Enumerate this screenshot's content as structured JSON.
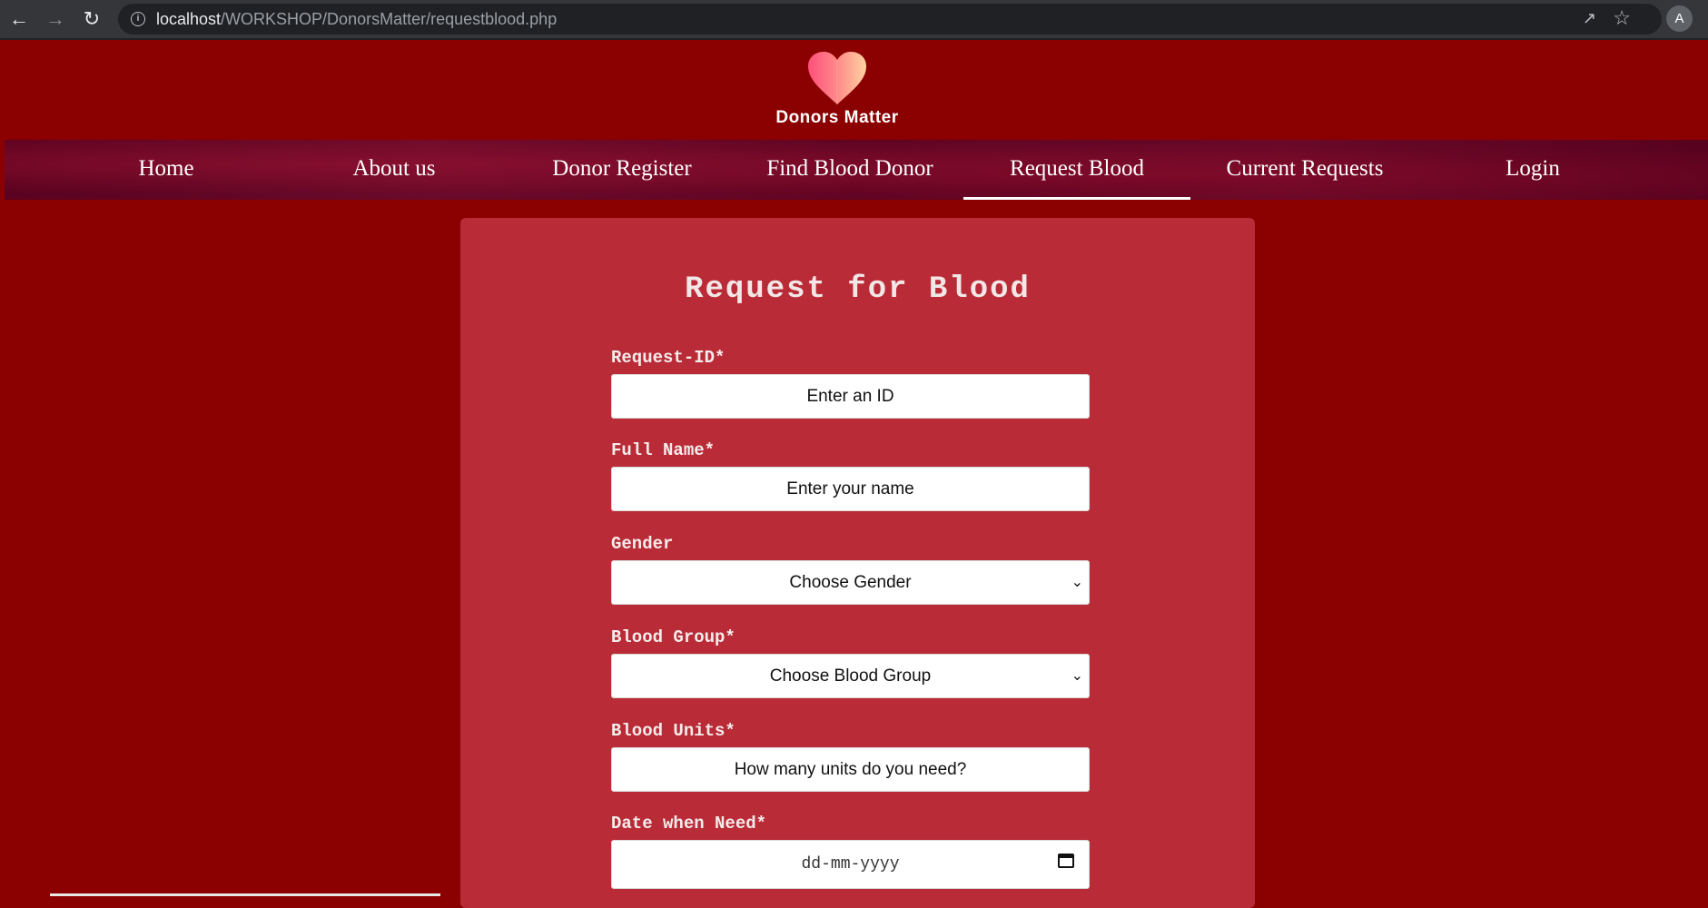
{
  "browser": {
    "url_host": "localhost",
    "url_path": "/WORKSHOP/DonorsMatter/requestblood.php",
    "avatar_letter": "A",
    "icons": [
      "back-icon",
      "forward-icon",
      "reload-icon",
      "info-icon",
      "share-icon",
      "star-icon"
    ]
  },
  "logo": {
    "text": "Donors Matter"
  },
  "nav": {
    "items": [
      {
        "label": "Home"
      },
      {
        "label": "About us"
      },
      {
        "label": "Donor Register"
      },
      {
        "label": "Find Blood Donor"
      },
      {
        "label": "Request Blood"
      },
      {
        "label": "Current Requests"
      },
      {
        "label": "Login"
      }
    ],
    "active": "Request Blood"
  },
  "form": {
    "title": "Request for Blood",
    "request_id": {
      "label": "Request-ID*",
      "placeholder": "Enter an ID"
    },
    "full_name": {
      "label": "Full Name*",
      "placeholder": "Enter your name"
    },
    "gender": {
      "label": "Gender",
      "selected": "Choose Gender"
    },
    "blood_group": {
      "label": "Blood Group*",
      "selected": "Choose Blood Group"
    },
    "blood_units": {
      "label": "Blood Units*",
      "placeholder": "How many units do you need?"
    },
    "date_needed": {
      "label": "Date when Need*",
      "placeholder": "dd-mm-yyyy"
    }
  },
  "colors": {
    "page_bg": "#8b0000",
    "card_bg": "#b92b36",
    "nav_bg": "#5c0322"
  }
}
